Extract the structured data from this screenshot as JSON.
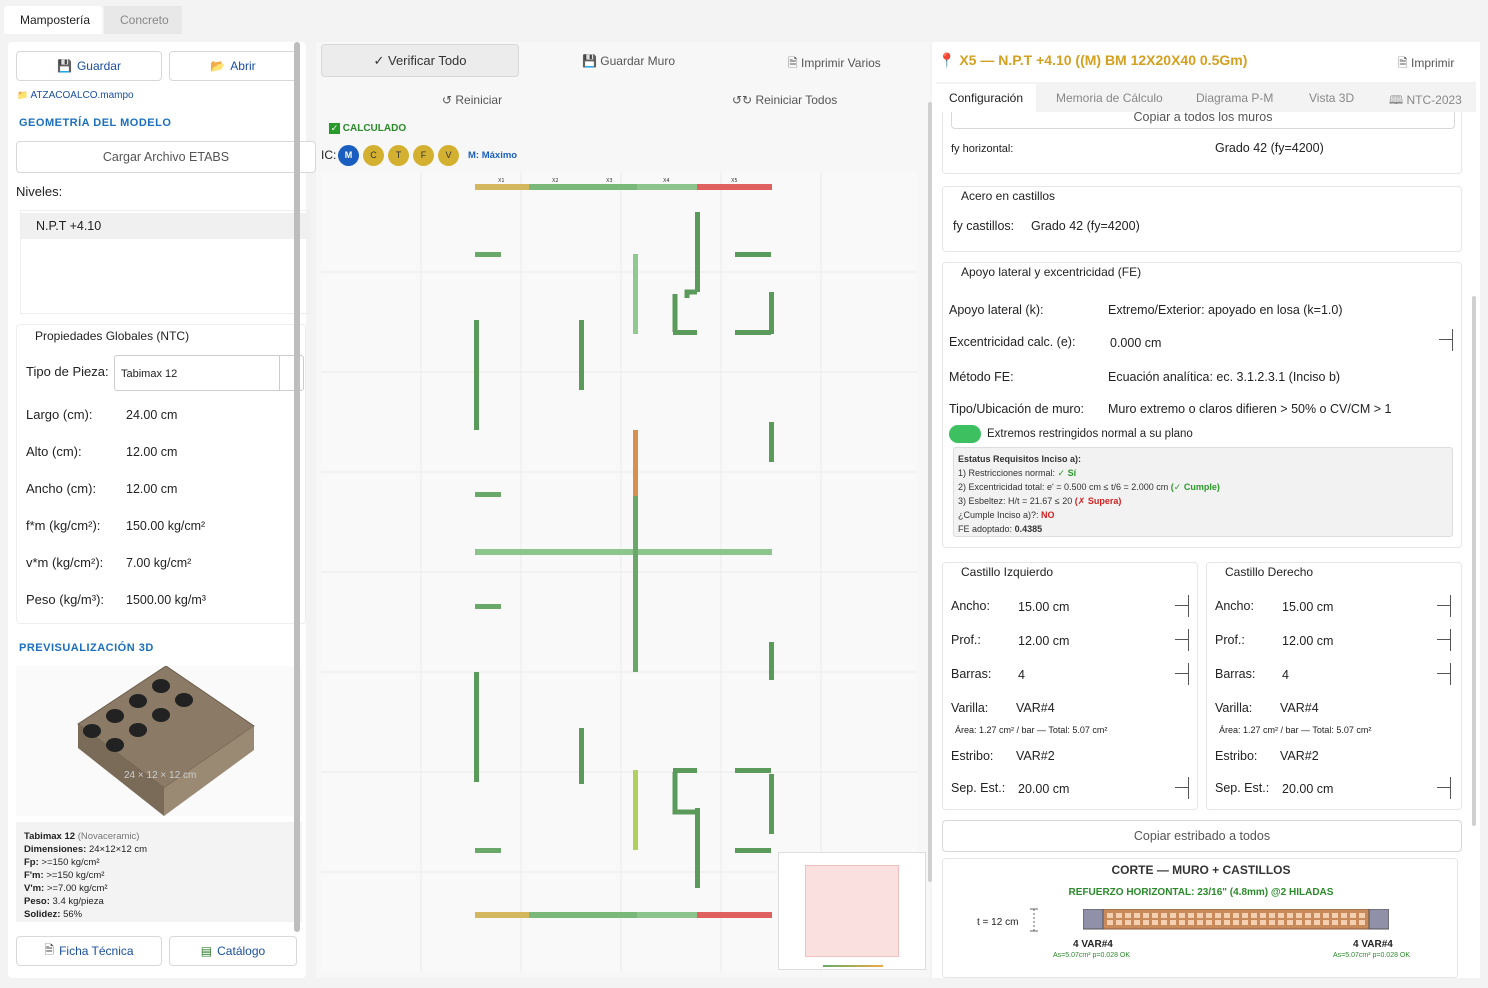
{
  "tabs": {
    "masonry": "Mampostería",
    "concrete": "Concreto"
  },
  "left": {
    "save": "Guardar",
    "open": "Abrir",
    "file_name": "ATZACOALCO.mampo",
    "geometry_title": "GEOMETRÍA DEL MODELO",
    "load_etabs": "Cargar Archivo ETABS",
    "levels_label": "Niveles:",
    "level_item": "N.P.T +4.10",
    "props_title": "Propiedades Globales (NTC)",
    "piece_type_label": "Tipo de Pieza:",
    "piece_type_value": "Tabimax 12",
    "length_label": "Largo (cm):",
    "length_value": "24.00 cm",
    "height_label": "Alto (cm):",
    "height_value": "12.00 cm",
    "width_label": "Ancho (cm):",
    "width_value": "12.00 cm",
    "fm_label": "f*m (kg/cm²):",
    "fm_value": "150.00 kg/cm²",
    "vm_label": "v*m (kg/cm²):",
    "vm_value": "7.00 kg/cm²",
    "weight_label": "Peso (kg/m³):",
    "weight_value": "1500.00 kg/m³",
    "preview_title": "PREVISUALIZACIÓN 3D",
    "brick_dims": "24 × 12 × 12 cm",
    "info": {
      "name": "Tabimax 12",
      "maker": "(Novaceramic)",
      "dims_k": "Dimensiones:",
      "dims_v": "24×12×12 cm",
      "fp_k": "Fp:",
      "fp_v": ">=150 kg/cm²",
      "fm_k": "F'm:",
      "fm_v": ">=150 kg/cm²",
      "vm_k": "V'm:",
      "vm_v": ">=7.00 kg/cm²",
      "peso_k": "Peso:",
      "peso_v": "3.4 kg/pieza",
      "solid_k": "Solidez:",
      "solid_v": "56%"
    },
    "datasheet": "Ficha Técnica",
    "catalog": "Catálogo"
  },
  "center": {
    "verify_all": "✓ Verificar Todo",
    "save_wall": "Guardar Muro",
    "print_many": "Imprimir Varios",
    "reset": "↺ Reiniciar",
    "reset_all": "Reiniciar Todos",
    "calculated": "CALCULADO",
    "ic_label": "IC:",
    "ic_buttons": [
      "M",
      "C",
      "T",
      "F",
      "V"
    ],
    "ic_legend": "M: Máximo"
  },
  "right": {
    "title": "X5  —  N.P.T +4.10  ((M) BM 12X20X40 0.5Gm)",
    "print": "Imprimir",
    "tabs": [
      "Configuración",
      "Memoria de Cálculo",
      "Diagrama P-M",
      "Vista 3D",
      "NTC-2023"
    ],
    "copy_all_walls": "Copiar a todos los muros",
    "fy_h_label": "fy horizontal:",
    "fy_h_value": "Grado 42 (fy=4200)",
    "steel_castle_title": "Acero en castillos",
    "fy_castle_label": "fy castillos:",
    "fy_castle_value": "Grado 42 (fy=4200)",
    "support_title": "Apoyo lateral y excentricidad (FE)",
    "support_label": "Apoyo lateral (k):",
    "support_value": "Extremo/Exterior: apoyado en losa (k=1.0)",
    "ecc_label": "Excentricidad calc. (e):",
    "ecc_value": "0.000 cm",
    "method_label": "Método FE:",
    "method_value": "Ecuación analítica: ec. 3.1.2.3.1 (Inciso b)",
    "type_label": "Tipo/Ubicación de muro:",
    "type_value": "Muro extremo o claros difieren > 50% o CV/CM > 1",
    "toggle_label": "Extremos restringidos normal a su plano",
    "status": {
      "title": "Estatus Requisitos Inciso a):",
      "l1": "1) Restricciones normal:",
      "l1_ok": "✓ Sí",
      "l2": "2) Excentricidad total: e' = 0.500 cm ≤ t/6 = 2.000 cm",
      "l2_ok": "(✓ Cumple)",
      "l3": "3) Esbeltez: H/t = 21.67 ≤ 20",
      "l3_bad": "(✗ Supera)",
      "l4": "¿Cumple Inciso a)?:",
      "l4_v": "NO",
      "l5": "FE adoptado:",
      "l5_v": "0.4385"
    },
    "castle_left": {
      "title": "Castillo Izquierdo",
      "width_label": "Ancho:",
      "width_value": "15.00 cm",
      "depth_label": "Prof.:",
      "depth_value": "12.00 cm",
      "bars_label": "Barras:",
      "bars_value": "4",
      "rebar_label": "Varilla:",
      "rebar_value": "VAR#4",
      "area": "Área: 1.27 cm² / bar — Total: 5.07 cm²",
      "stirrup_label": "Estribo:",
      "stirrup_value": "VAR#2",
      "sep_label": "Sep. Est.:",
      "sep_value": "20.00 cm"
    },
    "castle_right": {
      "title": "Castillo Derecho",
      "width_label": "Ancho:",
      "width_value": "15.00 cm",
      "depth_label": "Prof.:",
      "depth_value": "12.00 cm",
      "bars_label": "Barras:",
      "bars_value": "4",
      "rebar_label": "Varilla:",
      "rebar_value": "VAR#4",
      "area": "Área: 1.27 cm² / bar — Total: 5.07 cm²",
      "stirrup_label": "Estribo:",
      "stirrup_value": "VAR#2",
      "sep_label": "Sep. Est.:",
      "sep_value": "20.00 cm"
    },
    "copy_stirrup": "Copiar estribado a todos",
    "section_title": "CORTE — MURO + CASTILLOS",
    "section_sub": "REFUERZO HORIZONTAL: 23/16\" (4.8mm) @2 HILADAS",
    "thickness": "t = 12 cm",
    "rebar_left": "4 VAR#4",
    "rebar_left_sub": "As=5.07cm²  p=0.028  OK",
    "rebar_right": "4 VAR#4",
    "rebar_right_sub": "As=5.07cm²  p=0.028  OK"
  },
  "colors": {
    "accent": "#1a6fc0",
    "ok": "#2e8b2e",
    "bad": "#d02020",
    "title_gold": "#d4a020",
    "wall_green": "#5aa05a"
  }
}
